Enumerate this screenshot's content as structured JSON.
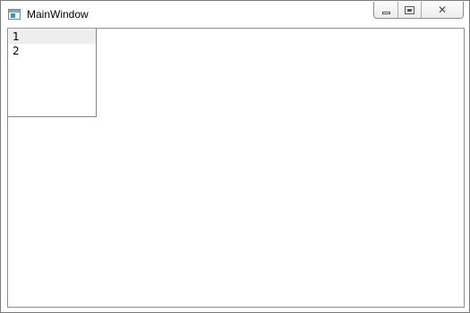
{
  "window": {
    "title": "MainWindow",
    "icon": "window-app-icon",
    "caption_buttons": {
      "minimize_icon": "minimize-icon",
      "maximize_icon": "maximize-icon",
      "close_label": "✕"
    }
  },
  "listbox": {
    "items": [
      {
        "label": "1",
        "selected": true
      },
      {
        "label": "2",
        "selected": false
      }
    ]
  },
  "colors": {
    "selection_background": "#eeeeee",
    "window_border": "#7a7a7a"
  }
}
